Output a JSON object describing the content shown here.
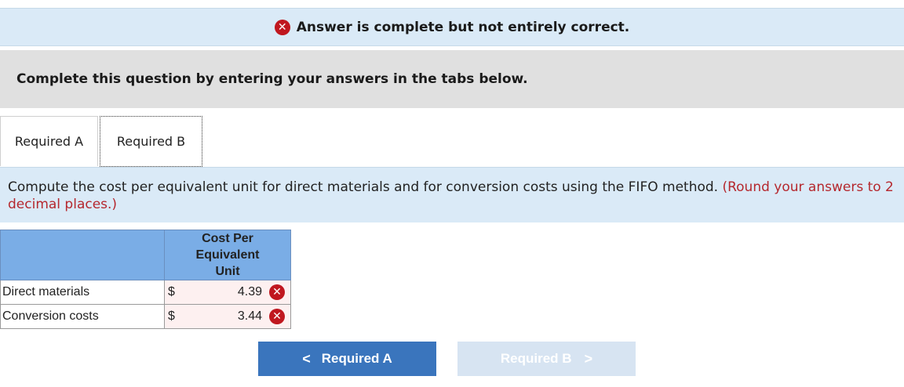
{
  "banner": {
    "status_icon": "x-circle-icon",
    "status_color": "#c0171f",
    "message": "Answer is complete but not entirely correct."
  },
  "instruction": "Complete this question by entering your answers in the tabs below.",
  "tabs": [
    {
      "label": "Required A",
      "active": false
    },
    {
      "label": "Required B",
      "active": true
    }
  ],
  "prompt": {
    "text": "Compute the cost per equivalent unit for direct materials and for conversion costs using the FIFO method.",
    "note": "(Round your answers to 2 decimal places.)"
  },
  "table": {
    "column_header": [
      "Cost Per",
      "Equivalent",
      "Unit"
    ],
    "rows": [
      {
        "label": "Direct materials",
        "currency": "$",
        "value": "4.39",
        "status": "incorrect"
      },
      {
        "label": "Conversion costs",
        "currency": "$",
        "value": "3.44",
        "status": "incorrect"
      }
    ]
  },
  "nav": {
    "prev": {
      "label": "Required A",
      "chevron": "<"
    },
    "next": {
      "label": "Required B",
      "chevron": ">",
      "disabled": true
    }
  },
  "colors": {
    "accent": "#3a75bd",
    "header_blue": "#7aade6",
    "error": "#c0171f"
  }
}
